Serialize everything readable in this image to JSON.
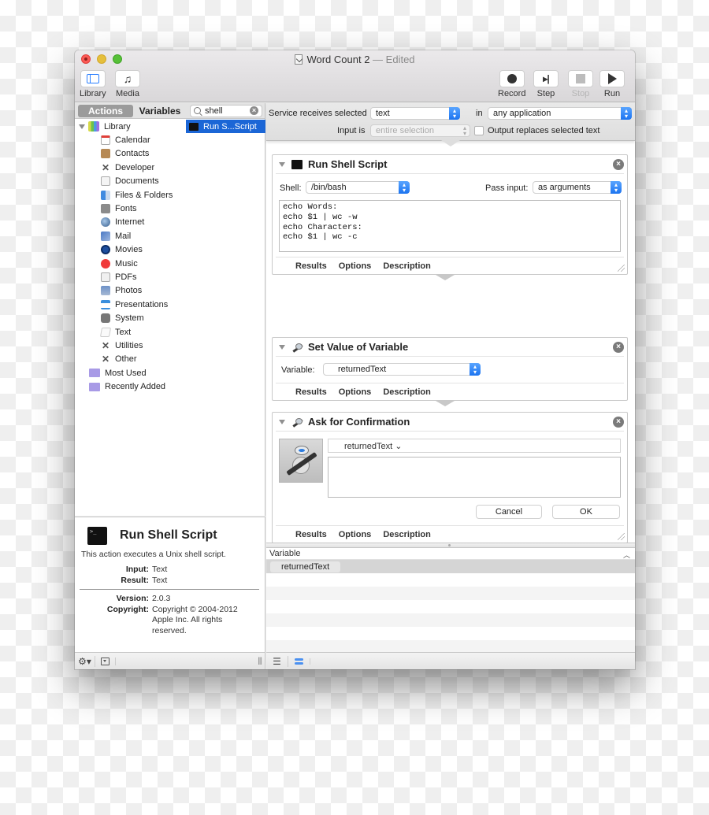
{
  "window": {
    "title": "Word Count 2",
    "title_separator": "—",
    "status": "Edited"
  },
  "toolbar": {
    "left": [
      {
        "label": "Library",
        "icon": "library-icon"
      },
      {
        "label": "Media",
        "icon": "music-note-icon"
      }
    ],
    "right": [
      {
        "label": "Record",
        "icon": "record-icon",
        "enabled": true
      },
      {
        "label": "Step",
        "icon": "step-icon",
        "enabled": true
      },
      {
        "label": "Stop",
        "icon": "stop-icon",
        "enabled": false
      },
      {
        "label": "Run",
        "icon": "play-icon",
        "enabled": true
      }
    ]
  },
  "library_pane": {
    "tabs": [
      "Actions",
      "Variables"
    ],
    "active_tab": "Actions",
    "search": {
      "value": "shell",
      "icon": "search-icon"
    },
    "tree": {
      "root": "Library",
      "children": [
        "Calendar",
        "Contacts",
        "Developer",
        "Documents",
        "Files & Folders",
        "Fonts",
        "Internet",
        "Mail",
        "Movies",
        "Music",
        "PDFs",
        "Photos",
        "Presentations",
        "System",
        "Text",
        "Utilities",
        "Other"
      ],
      "smart_groups": [
        "Most Used",
        "Recently Added"
      ]
    },
    "results": [
      {
        "label": "Run S...Script",
        "selected": true
      }
    ]
  },
  "description": {
    "title": "Run Shell Script",
    "summary": "This action executes a Unix shell script.",
    "input_label": "Input:",
    "input": "Text",
    "result_label": "Result:",
    "result": "Text",
    "version_label": "Version:",
    "version": "2.0.3",
    "copyright_label": "Copyright:",
    "copyright": "Copyright © 2004-2012 Apple Inc.  All rights reserved."
  },
  "service": {
    "receives_label": "Service receives selected",
    "receives_value": "text",
    "in_label": "in",
    "in_value": "any application",
    "input_is_label": "Input is",
    "input_is_value": "entire selection",
    "output_replaces_label": "Output replaces selected text",
    "output_replaces_checked": false
  },
  "actions": [
    {
      "title": "Run Shell Script",
      "shell_label": "Shell:",
      "shell_value": "/bin/bash",
      "pass_input_label": "Pass input:",
      "pass_input_value": "as arguments",
      "script": "echo Words:\necho $1 | wc -w\necho Characters:\necho $1 | wc -c",
      "footer": [
        "Results",
        "Options",
        "Description"
      ]
    },
    {
      "title": "Set Value of Variable",
      "variable_label": "Variable:",
      "variable_value": "returnedText",
      "footer": [
        "Results",
        "Options",
        "Description"
      ]
    },
    {
      "title": "Ask for Confirmation",
      "message_token": "returnedText ⌄",
      "detail_text": "",
      "cancel_label": "Cancel",
      "ok_label": "OK",
      "footer": [
        "Results",
        "Options",
        "Description"
      ]
    }
  ],
  "variables_pane": {
    "header": "Variable",
    "rows": [
      "returnedText"
    ]
  }
}
